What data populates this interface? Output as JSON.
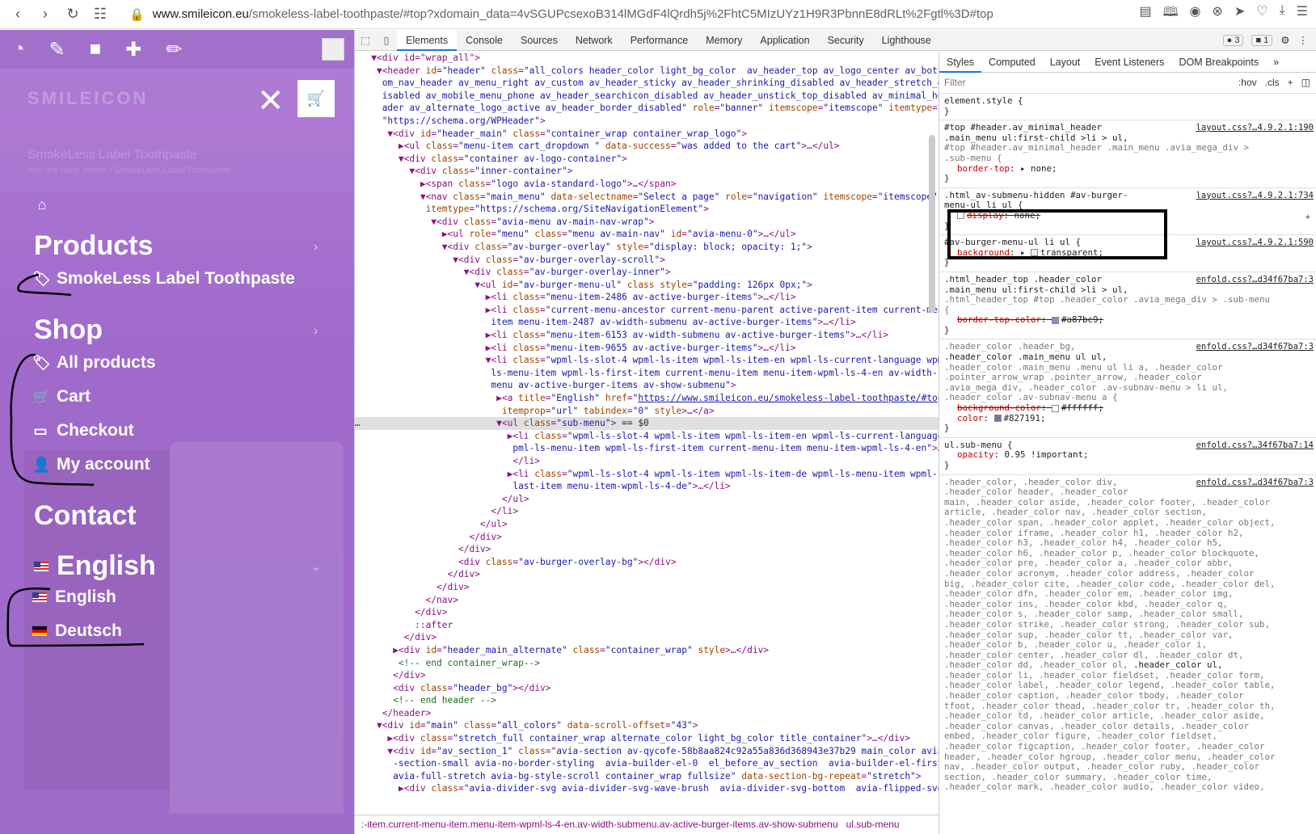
{
  "browser": {
    "url_host": "www.smileicon.eu",
    "url_path": "/smokeless-label-toothpaste/#top?xdomain_data=4vSGUPcsexoB314lMGdF4lQrdh5j%2FhtC5MIzUYz1H9R3PbnnE8dRLt%2Fgtl%3D#top"
  },
  "site": {
    "logo": "SMILEICON",
    "ghost_title": "SmokeLess Label Toothpaste",
    "ghost_crumb": "You are here:  Home  /  SmokeLess Label Toothpaste",
    "menu": {
      "products": "Products",
      "smokeless": "SmokeLess Label Toothpaste",
      "shop": "Shop",
      "all_products": "All products",
      "cart": "Cart",
      "checkout": "Checkout",
      "my_account": "My account",
      "contact": "Contact",
      "english_top": "English",
      "english": "English",
      "deutsch": "Deutsch"
    }
  },
  "devtools": {
    "tabs": [
      "Elements",
      "Console",
      "Sources",
      "Network",
      "Performance",
      "Memory",
      "Application",
      "Security",
      "Lighthouse"
    ],
    "badge_errors": "3",
    "badge_msgs": "1",
    "breadcrumb": ":-item.current-menu-item.menu-item-wpml-ls-4-en.av-width-submenu.av-active-burger-items.av-show-submenu",
    "breadcrumb_last": "ul.sub-menu",
    "styles_tabs": [
      "Styles",
      "Computed",
      "Layout",
      "Event Listeners",
      "DOM Breakpoints"
    ],
    "filter_placeholder": "Filter",
    "hov": ":hov",
    "cls": ".cls"
  }
}
